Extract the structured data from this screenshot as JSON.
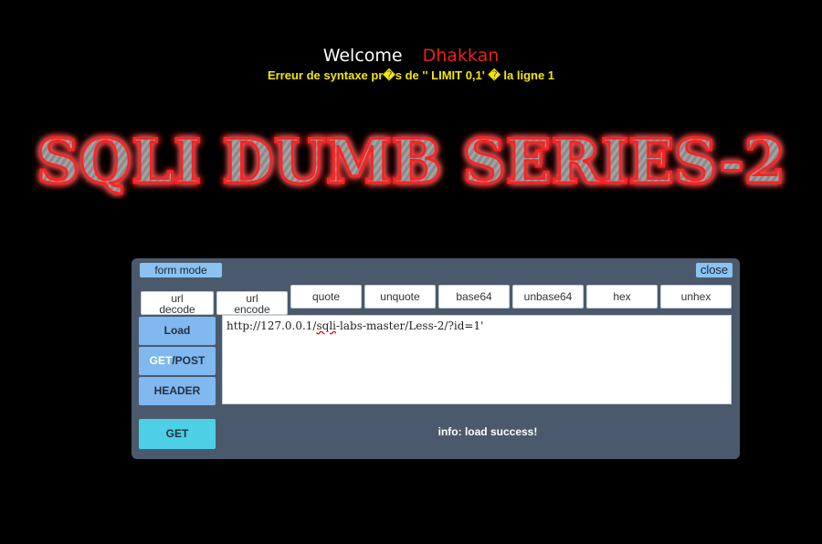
{
  "header": {
    "welcome": "Welcome",
    "username": "Dhakkan",
    "error": "Erreur de syntaxe pr�s de '' LIMIT 0,1' � la ligne 1"
  },
  "logo": {
    "text": "SQLI DUMB SERIES-2",
    "fill_color": "#9a9a9a",
    "glow_color": "#ff1a1a"
  },
  "toolbar": {
    "form_mode": "form mode",
    "close": "close",
    "url_decode": [
      "url",
      "decode"
    ],
    "url_encode": [
      "url",
      "encode"
    ],
    "quote": "quote",
    "unquote": "unquote",
    "base64": "base64",
    "unbase64": "unbase64",
    "hex": "hex",
    "unhex": "unhex"
  },
  "side": {
    "load": "Load",
    "get": "GET",
    "post": "/POST",
    "header": "HEADER"
  },
  "url": {
    "prefix": "http://127.0.0.1/",
    "squiggle": "sqli",
    "suffix": "-labs-master/Less-2/?id=1'"
  },
  "submit": {
    "label": "GET"
  },
  "info": {
    "message": "info: load success!"
  }
}
